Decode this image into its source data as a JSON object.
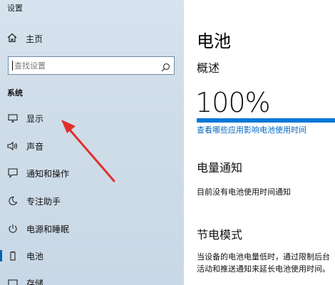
{
  "window": {
    "title": "设置"
  },
  "sidebar": {
    "home_label": "主页",
    "search": {
      "placeholder": "查找设置"
    },
    "section_label": "系统",
    "items": [
      {
        "label": "显示",
        "icon": "monitor-icon"
      },
      {
        "label": "声音",
        "icon": "speaker-icon"
      },
      {
        "label": "通知和操作",
        "icon": "notification-icon"
      },
      {
        "label": "专注助手",
        "icon": "moon-icon"
      },
      {
        "label": "电源和睡眠",
        "icon": "power-icon"
      },
      {
        "label": "电池",
        "icon": "battery-icon",
        "active": true
      },
      {
        "label": "存储",
        "icon": "storage-icon"
      }
    ]
  },
  "main": {
    "title": "电池",
    "overview_heading": "概述",
    "battery_percent": "100%",
    "battery_level": 1.0,
    "usage_link": "查看哪些应用影响电池使用时间",
    "notification_heading": "电量通知",
    "notification_text": "目前没有电池使用时间通知",
    "saver_heading": "节电模式",
    "saver_text": "当设备的电池电量低时，通过限制后台活动和推送通知来延长电池使用时间。"
  },
  "colors": {
    "accent": "#0078d7",
    "link": "#0067c0",
    "annotation_arrow": "#e0302a"
  }
}
